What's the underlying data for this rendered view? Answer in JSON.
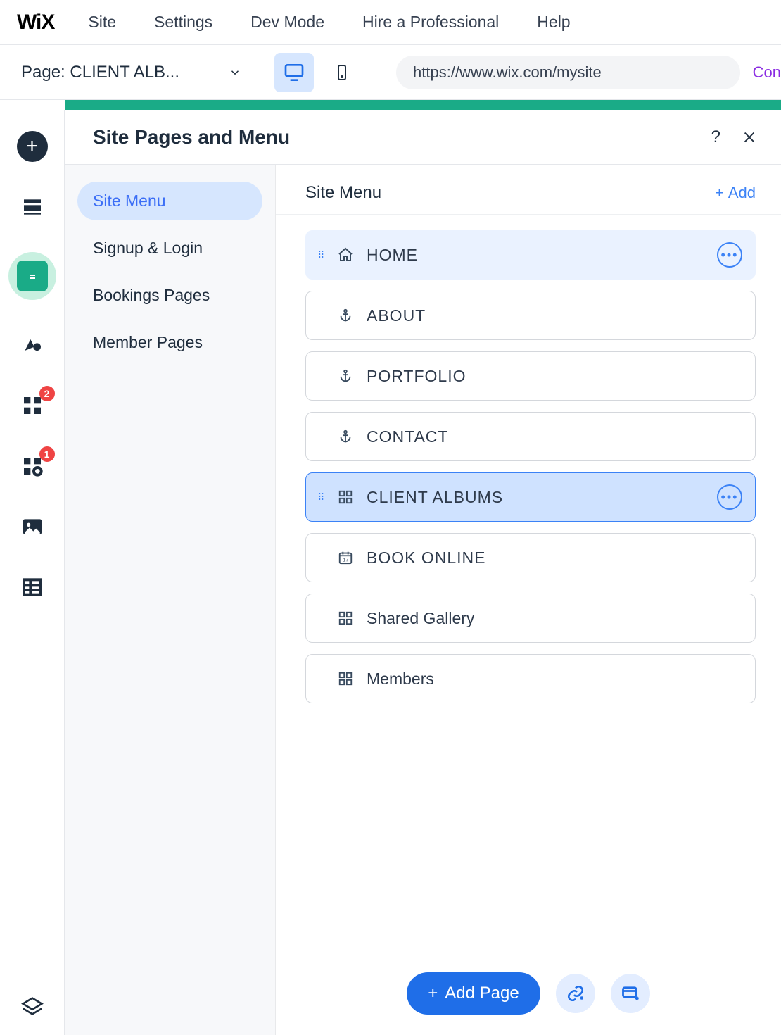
{
  "brand": "WiX",
  "topmenu": [
    "Site",
    "Settings",
    "Dev Mode",
    "Hire a Professional",
    "Help"
  ],
  "page_selector": {
    "label": "Page: CLIENT ALB..."
  },
  "url": "https://www.wix.com/mysite",
  "url_right": "Con",
  "leftrail": {
    "badges": {
      "apps": "2",
      "appmarket": "1"
    }
  },
  "panel": {
    "title": "Site Pages and Menu",
    "help": "?",
    "sidebar": [
      {
        "label": "Site Menu",
        "active": true
      },
      {
        "label": "Signup & Login"
      },
      {
        "label": "Bookings Pages"
      },
      {
        "label": "Member Pages"
      }
    ],
    "menu_head": {
      "title": "Site Menu",
      "add": "Add"
    },
    "items": [
      {
        "label": "HOME",
        "icon": "home",
        "state": "home-sel",
        "dots": true,
        "drag": true
      },
      {
        "label": "ABOUT",
        "icon": "anchor"
      },
      {
        "label": "PORTFOLIO",
        "icon": "anchor"
      },
      {
        "label": "CONTACT",
        "icon": "anchor"
      },
      {
        "label": "CLIENT ALBUMS",
        "icon": "grid",
        "state": "current-sel",
        "dots": true,
        "drag": true
      },
      {
        "label": "BOOK ONLINE",
        "icon": "calendar"
      },
      {
        "label": "Shared Gallery",
        "icon": "grid"
      },
      {
        "label": "Members",
        "icon": "grid"
      }
    ],
    "footer": {
      "add_page": "Add Page"
    }
  }
}
